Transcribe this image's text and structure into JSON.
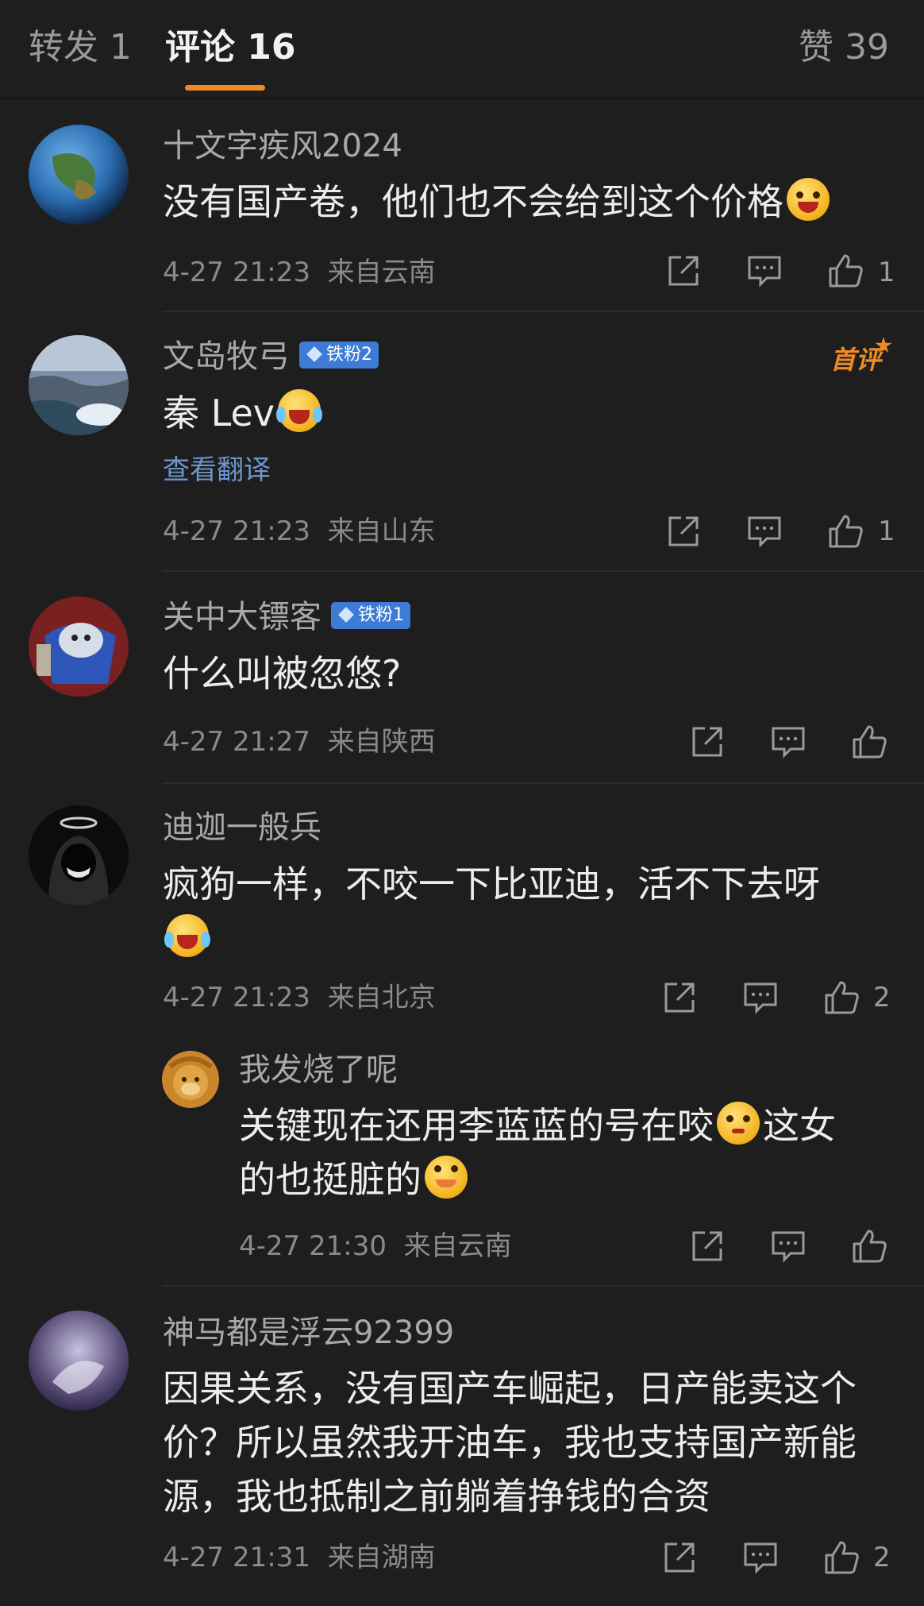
{
  "tabs": {
    "repost": "转发 1",
    "comments": "评论 16",
    "likes": "赞 39"
  },
  "comments": [
    {
      "user": "十文字疾风2024",
      "text": "没有国产卷，他们也不会给到这个价格",
      "time": "4-27 21:23",
      "location": "来自云南",
      "likes": "1"
    },
    {
      "user": "文岛牧弓",
      "badge": "铁粉2",
      "first_comment_tag": "首评",
      "text": "秦 Lev",
      "translate": "查看翻译",
      "time": "4-27 21:23",
      "location": "来自山东",
      "likes": "1"
    },
    {
      "user": "关中大镖客",
      "badge": "铁粉1",
      "text": "什么叫被忽悠?",
      "time": "4-27 21:27",
      "location": "来自陕西",
      "likes": ""
    },
    {
      "user": "迪迦一般兵",
      "text": "疯狗一样，不咬一下比亚迪，活不下去呀",
      "time": "4-27 21:23",
      "location": "来自北京",
      "likes": "2"
    },
    {
      "user": "我发烧了呢",
      "text_part1": "关键现在还用李蓝蓝的号在咬",
      "text_part2": "这女",
      "text_part3": "的也挺脏的",
      "time": "4-27 21:30",
      "location": "来自云南",
      "likes": ""
    },
    {
      "user": "神马都是浮云92399",
      "text": "因果关系，没有国产车崛起，日产能卖这个价？所以虽然我开油车，我也支持国产新能源，我也抵制之前躺着挣钱的合资",
      "time": "4-27 21:31",
      "location": "来自湖南",
      "likes": "2"
    }
  ],
  "icons": {
    "share": "share-icon",
    "comment": "comment-icon",
    "like": "thumb-up-icon"
  },
  "colors": {
    "background": "#1e1e1e",
    "accent": "#f08a24",
    "badge": "#3d7bd6",
    "translate_link": "#6e96cc"
  }
}
